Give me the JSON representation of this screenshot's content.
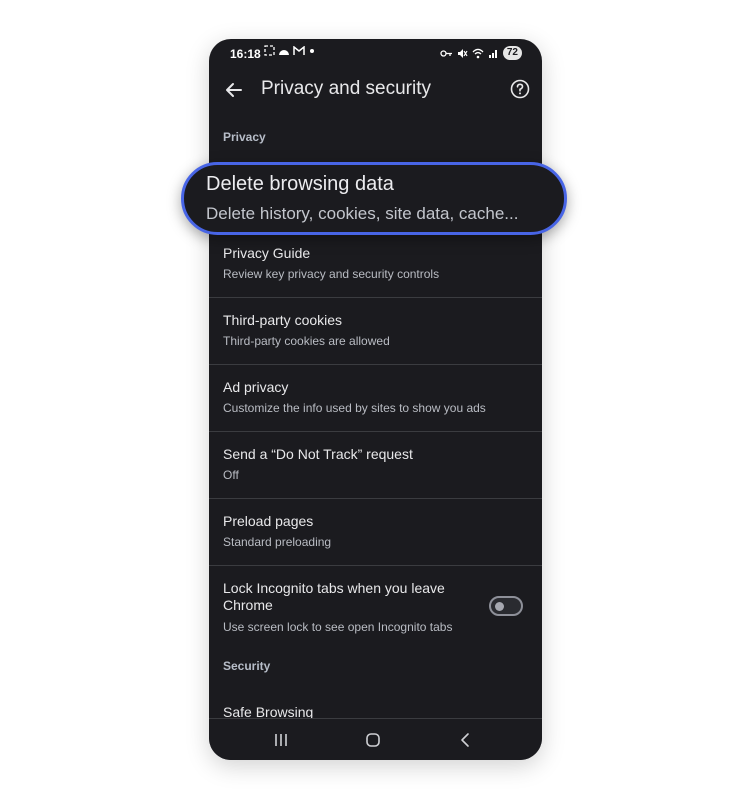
{
  "status_bar": {
    "time": "16:18",
    "battery": "72"
  },
  "app_bar": {
    "title": "Privacy and security"
  },
  "sections": {
    "privacy_header": "Privacy",
    "security_header": "Security"
  },
  "highlight": {
    "title": "Delete browsing data",
    "subtitle": "Delete history, cookies, site data, cache..."
  },
  "items": [
    {
      "title": "Privacy Guide",
      "subtitle": "Review key privacy and security controls"
    },
    {
      "title": "Third-party cookies",
      "subtitle": "Third-party cookies are allowed"
    },
    {
      "title": "Ad privacy",
      "subtitle": "Customize the info used by sites to show you ads"
    },
    {
      "title": "Send a “Do Not Track” request",
      "subtitle": "Off"
    },
    {
      "title": "Preload pages",
      "subtitle": "Standard preloading"
    }
  ],
  "lock_item": {
    "title": "Lock Incognito tabs when you leave Chrome",
    "subtitle": "Use screen lock to see open Incognito tabs",
    "toggle_on": false
  },
  "security_items": [
    {
      "title": "Safe Browsing"
    }
  ],
  "colors": {
    "background": "#1b1b1f",
    "highlight_border": "#4865e6",
    "divider": "#3b3c40"
  }
}
